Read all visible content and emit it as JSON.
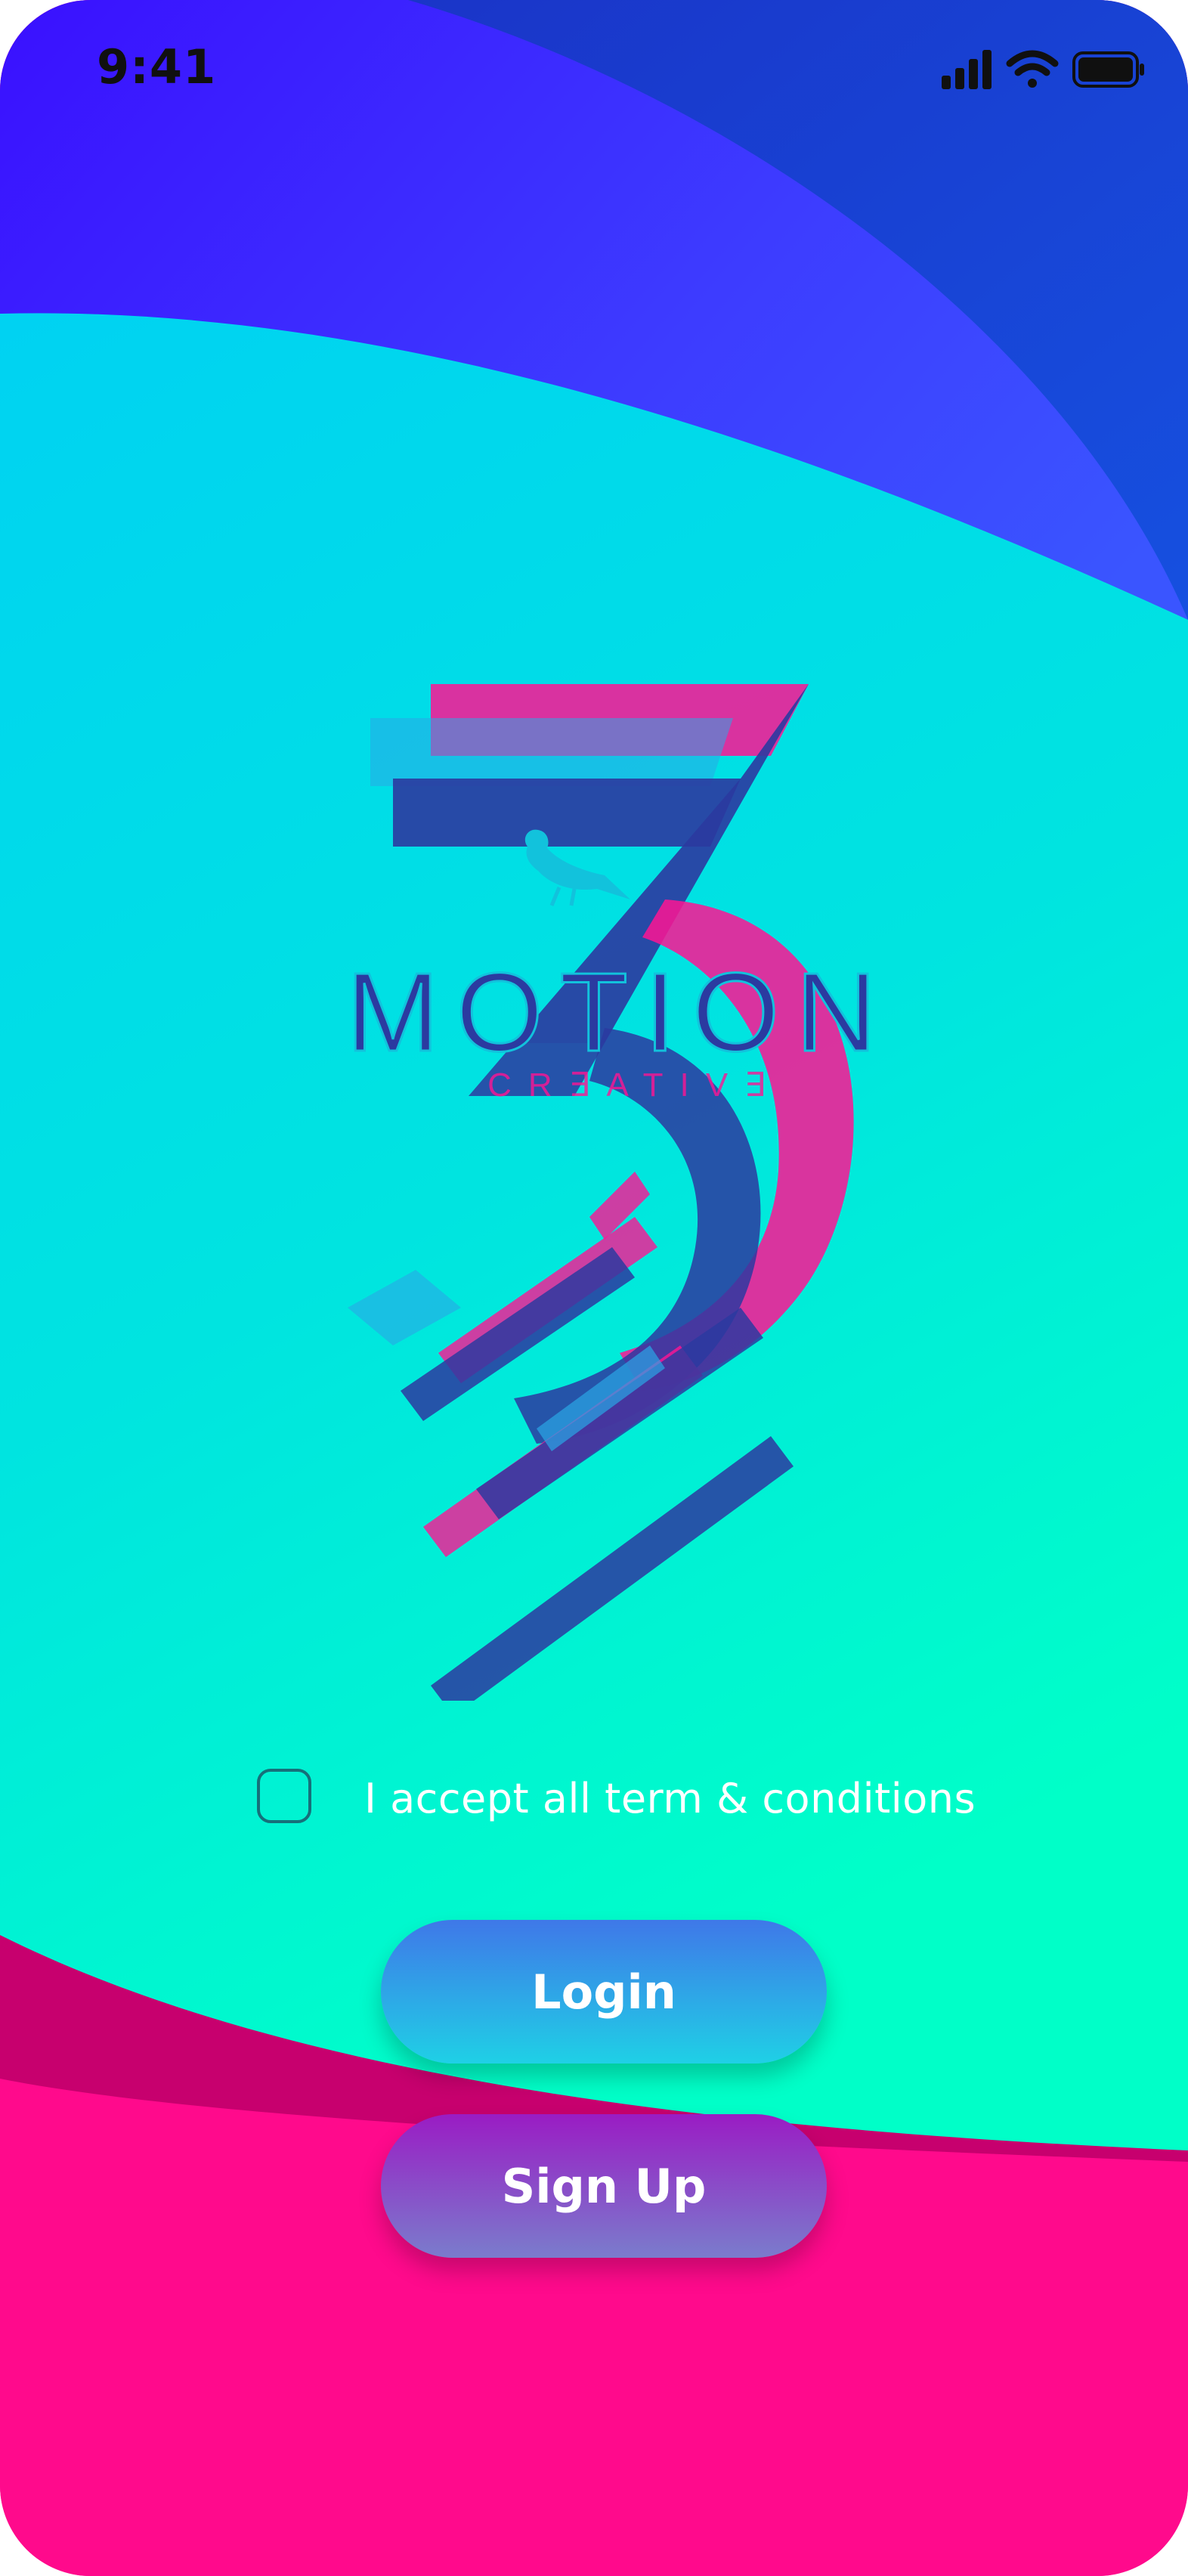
{
  "status_bar": {
    "time": "9:41",
    "icons": [
      "cellular-signal-icon",
      "wifi-icon",
      "battery-icon"
    ]
  },
  "logo": {
    "wordmark": "MOTION",
    "subtitle": "CR∃ATIV∃",
    "emblem": "stylized-3-with-bird-icon"
  },
  "terms": {
    "checked": false,
    "label": "I accept all term & conditions"
  },
  "buttons": {
    "login": "Login",
    "signup": "Sign Up"
  },
  "colors": {
    "top_blue": "#3a1bff",
    "cyan": "#00d6f0",
    "mint": "#00ffcc",
    "magenta": "#ff0a8c",
    "dark_magenta": "#c7006e",
    "logo_navy": "#2b3aa0",
    "logo_pink": "#ff1493"
  }
}
